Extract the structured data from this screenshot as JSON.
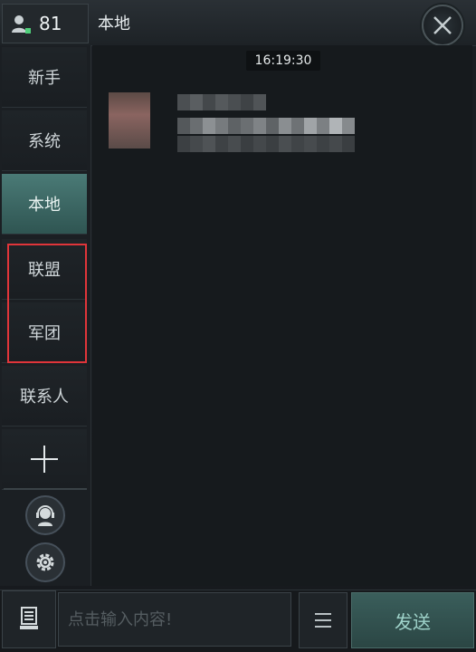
{
  "header": {
    "level_value": "81",
    "channel_title": "本地",
    "user_icon": "user-level-icon",
    "close_icon": "close-icon"
  },
  "sidebar": {
    "tabs": [
      {
        "id": "newbie",
        "label": "新手"
      },
      {
        "id": "system",
        "label": "系统"
      },
      {
        "id": "local",
        "label": "本地",
        "active": true
      },
      {
        "id": "alliance",
        "label": "联盟"
      },
      {
        "id": "legion",
        "label": "军团"
      },
      {
        "id": "contacts",
        "label": "联系人"
      }
    ],
    "add_icon": "plus-icon",
    "support_icon": "customer-support-icon",
    "settings_icon": "gear-icon",
    "highlight_color": "#e0353a"
  },
  "chat": {
    "timestamp": "16:19:30"
  },
  "input_bar": {
    "keyboard_icon": "voice-keyboard-icon",
    "placeholder": "点击输入内容!",
    "menu_icon": "menu-icon",
    "send_label": "发送"
  },
  "colors": {
    "accent": "#4a7a76",
    "send_text": "#9fd3ca"
  }
}
